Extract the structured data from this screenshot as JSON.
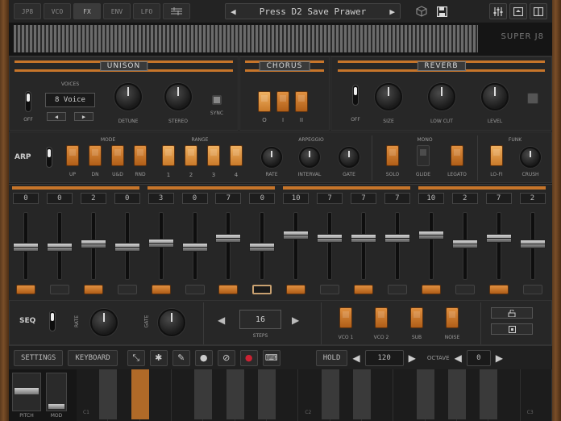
{
  "tabs": [
    "JP8",
    "VCO",
    "FX",
    "ENV",
    "LFO"
  ],
  "active_tab": "FX",
  "preset": {
    "prev": "◀",
    "name": "Press D2 Save Prawer",
    "next": "▶"
  },
  "top_icons": [
    "sequencer-grid-icon",
    "cube-icon",
    "save-icon",
    "mixer-icon",
    "window-icon",
    "split-view-icon"
  ],
  "logo": "SUPER J8",
  "unison": {
    "title": "UNISON",
    "voices_label": "VOICES",
    "voices_value": "8 Voice",
    "off_label": "OFF",
    "detune_label": "DETUNE",
    "stereo_label": "STEREO",
    "sync_label": "SYNC"
  },
  "chorus": {
    "title": "CHORUS",
    "modes": [
      "O",
      "I",
      "II"
    ]
  },
  "reverb": {
    "title": "REVERB",
    "off_label": "OFF",
    "size_label": "SIZE",
    "lowcut_label": "LOW CUT",
    "level_label": "LEVEL"
  },
  "arp": {
    "label": "ARP",
    "mode_label": "MODE",
    "modes": [
      "UP",
      "DN",
      "U&D",
      "RND"
    ],
    "range_label": "RANGE",
    "ranges": [
      "1",
      "2",
      "3",
      "4"
    ],
    "arpeggio_label": "ARPEGGIO",
    "knobs": [
      "RATE",
      "INTERVAL",
      "GATE"
    ]
  },
  "mono": {
    "label": "MONO",
    "buttons": [
      "SOLO",
      "GLIDE",
      "LEGATO"
    ]
  },
  "funk": {
    "label": "FUNK",
    "buttons": [
      "LO-FI",
      "CRUSH"
    ]
  },
  "steps": {
    "values": [
      "0",
      "0",
      "2",
      "0",
      "3",
      "0",
      "7",
      "0",
      "10",
      "7",
      "7",
      "7",
      "10",
      "2",
      "7",
      "2"
    ],
    "levels": [
      0.49,
      0.49,
      0.53,
      0.49,
      0.55,
      0.49,
      0.62,
      0.49,
      0.67,
      0.62,
      0.62,
      0.62,
      0.67,
      0.53,
      0.62,
      0.53
    ],
    "gates": [
      1,
      0,
      1,
      0,
      1,
      0,
      1,
      2,
      1,
      0,
      1,
      0,
      1,
      0,
      1,
      0
    ]
  },
  "seq": {
    "label": "SEQ",
    "rate_label": "RATE",
    "gate_label": "GATE",
    "steps_value": "16",
    "steps_label": "STEPS",
    "prev": "◀",
    "next": "▶",
    "osc_buttons": [
      "VCO 1",
      "VCO 2",
      "SUB",
      "NOISE"
    ]
  },
  "ctrlbar": {
    "settings": "SETTINGS",
    "keyboard": "KEYBOARD",
    "hold": "HOLD",
    "tempo": "120",
    "octave_label": "OCTAVE",
    "octave": "0",
    "prev": "◀",
    "next": "▶"
  },
  "keyboard": {
    "pitch_label": "PITCH",
    "mod_label": "MOD",
    "notes": [
      "C1",
      "C2",
      "C3"
    ]
  },
  "colors": {
    "accent": "#c7752a",
    "background": "#1e1e1e"
  }
}
